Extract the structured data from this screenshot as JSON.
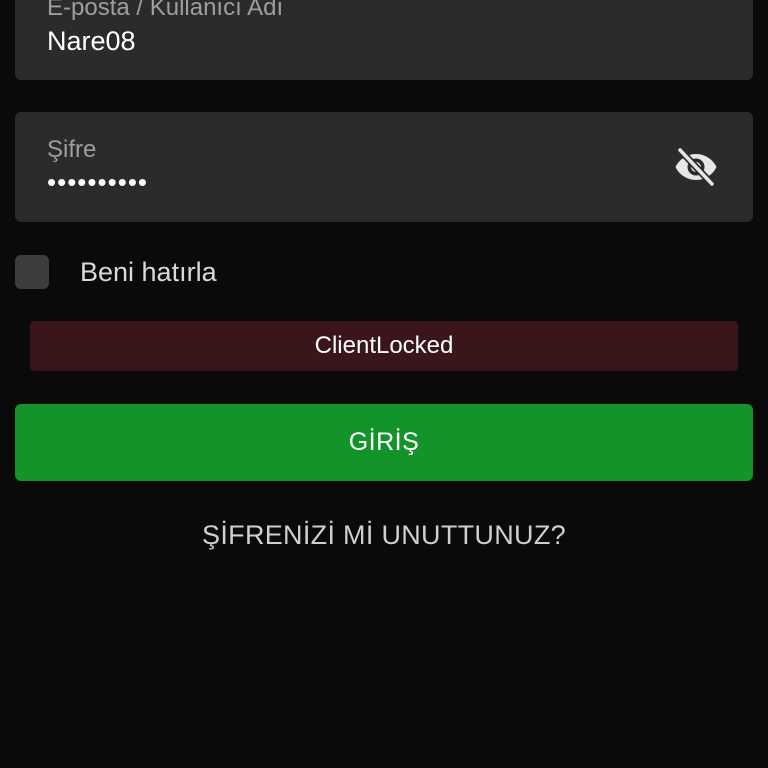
{
  "login_form": {
    "username": {
      "label": "E-posta / Kullanıcı Adı",
      "value": "Nare08"
    },
    "password": {
      "label": "Şifre",
      "masked_value": "••••••••••",
      "toggle_icon": "eye-off-icon"
    },
    "remember_me": {
      "label": "Beni hatırla",
      "checked": false
    },
    "error_message": "ClientLocked",
    "login_button_label": "GİRİŞ",
    "forgot_password_label": "ŞİFRENİZİ Mİ UNUTTUNUZ?"
  },
  "colors": {
    "background": "#0a0a0a",
    "field_background": "#2b2b2b",
    "error_background": "#3a1519",
    "primary_button": "#13942a",
    "label_text": "#9e9e9e"
  }
}
